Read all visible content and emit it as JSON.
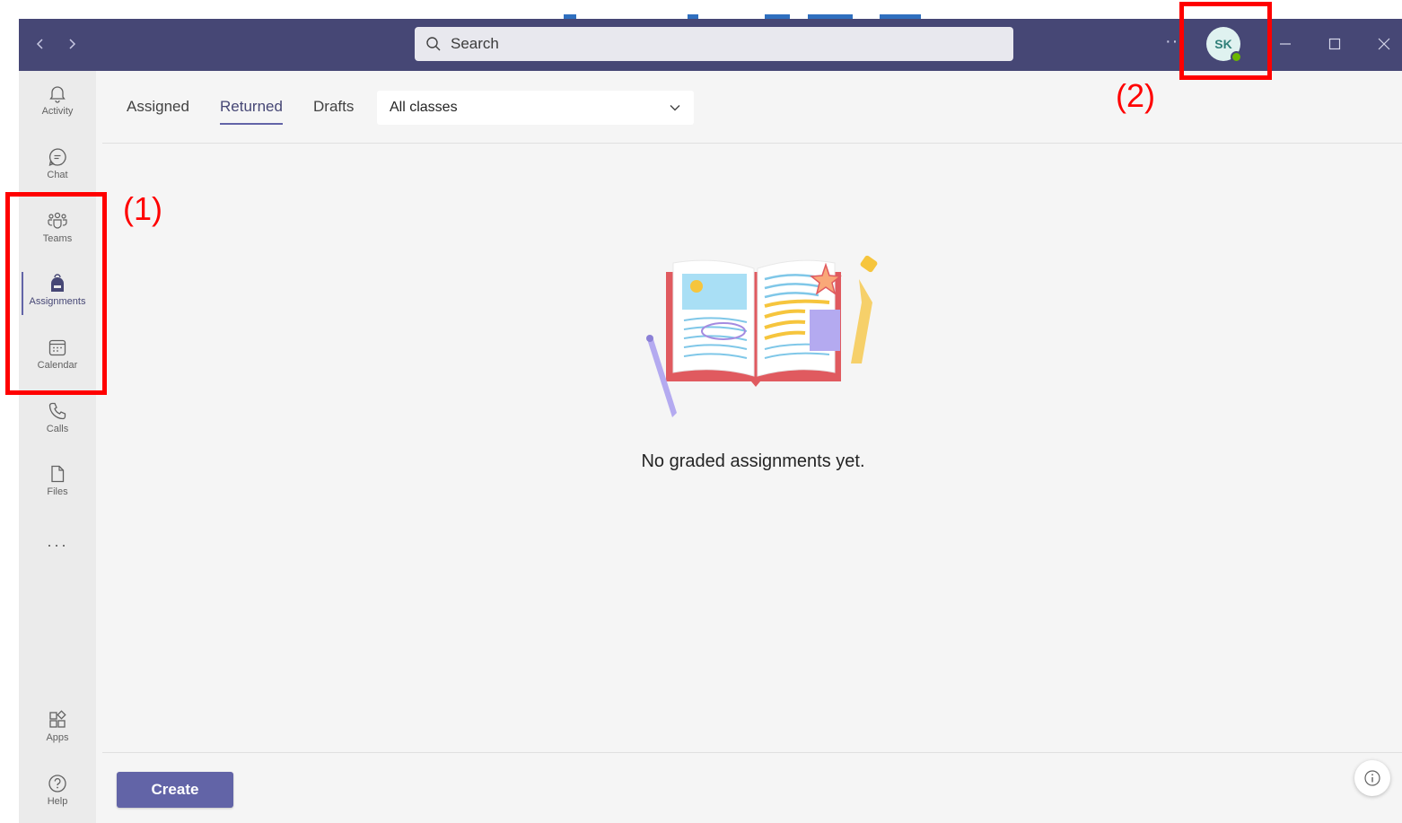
{
  "titlebar": {
    "search_placeholder": "Search",
    "more_label": "···",
    "avatar_initials": "SK",
    "status": "available"
  },
  "rail": {
    "items": [
      {
        "label": "Activity",
        "icon": "bell-icon"
      },
      {
        "label": "Chat",
        "icon": "chat-icon"
      },
      {
        "label": "Teams",
        "icon": "teams-icon"
      },
      {
        "label": "Assignments",
        "icon": "backpack-icon",
        "active": true
      },
      {
        "label": "Calendar",
        "icon": "calendar-icon"
      },
      {
        "label": "Calls",
        "icon": "phone-icon"
      },
      {
        "label": "Files",
        "icon": "file-icon"
      }
    ],
    "more_label": "···",
    "bottom_items": [
      {
        "label": "Apps",
        "icon": "apps-icon"
      },
      {
        "label": "Help",
        "icon": "help-icon"
      }
    ]
  },
  "tabs": [
    {
      "label": "Assigned"
    },
    {
      "label": "Returned",
      "active": true
    },
    {
      "label": "Drafts"
    }
  ],
  "class_filter": {
    "selected": "All classes"
  },
  "empty_state": {
    "message": "No graded assignments yet."
  },
  "footer": {
    "create_label": "Create"
  },
  "annotations": [
    {
      "label": "(1)"
    },
    {
      "label": "(2)"
    }
  ],
  "colors": {
    "titlebar": "#464775",
    "accent": "#6264a7",
    "callout": "#ff0000",
    "rail_bg": "#ebebeb",
    "content_bg": "#f5f5f5"
  }
}
